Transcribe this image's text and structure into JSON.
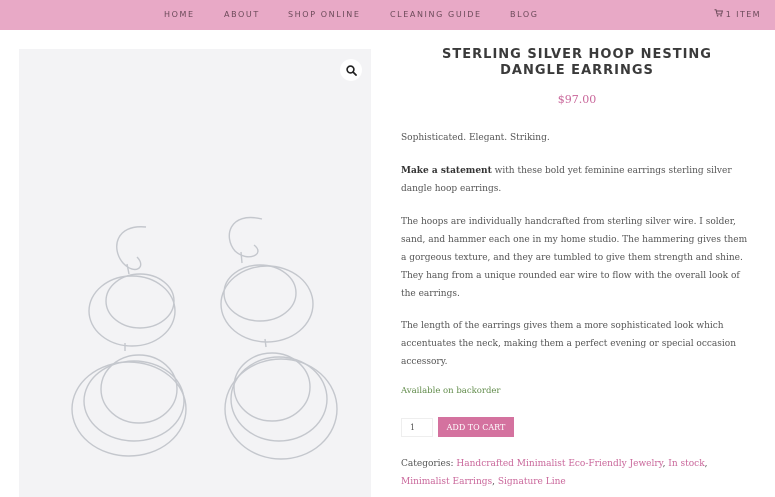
{
  "nav": {
    "items": [
      "HOME",
      "ABOUT",
      "SHOP ONLINE",
      "CLEANING GUIDE",
      "BLOG"
    ],
    "cart_label": "1 ITEM",
    "cart_icon": "cart-icon"
  },
  "gallery": {
    "zoom_icon": "magnifier-icon",
    "image_subject": "earrings"
  },
  "product": {
    "title": "STERLING SILVER HOOP NESTING DANGLE EARRINGS",
    "price": "$97.00",
    "tagline": "Sophisticated. Elegant. Striking.",
    "p1_bold": "Make a statement",
    "p1_rest": " with these bold yet feminine earrings sterling silver dangle hoop earrings.",
    "p2": "The hoops are individually handcrafted from sterling silver wire. I solder, sand, and hammer each one in my home studio. The hammering gives them a gorgeous texture, and they are tumbled to give them strength and shine. They hang from a unique rounded ear wire to flow with the overall look of the earrings.",
    "p3": "The length of the earrings gives them a more sophisticated look which accentuates the neck, making them a perfect evening or special occasion accessory.",
    "stock": "Available on backorder",
    "quantity": "1",
    "add_to_cart": "ADD TO CART",
    "categories_label": "Categories:",
    "categories": [
      "Handcrafted Minimalist Eco-Friendly Jewelry",
      "In stock",
      "Minimalist Earrings",
      "Signature Line"
    ]
  },
  "colors": {
    "nav_bg": "#e8a9c6",
    "accent": "#c9669a",
    "button": "#d4729f",
    "stock": "#5f8a48"
  }
}
